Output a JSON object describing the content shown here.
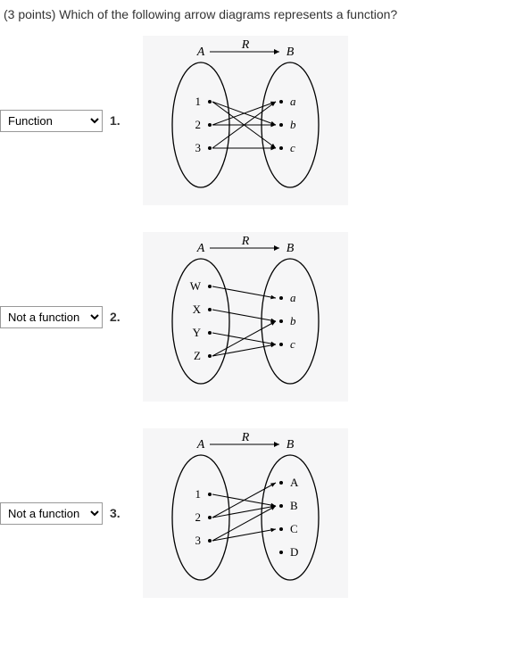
{
  "question": "(3 points) Which of the following arrow diagrams represents a function?",
  "options": [
    "Function",
    "Not a function"
  ],
  "items": [
    {
      "num": "1.",
      "selected": "Function",
      "setA_label": "A",
      "setB_label": "B",
      "rel_label": "R",
      "domain": [
        "1",
        "2",
        "3"
      ],
      "codomain": [
        "a",
        "b",
        "c"
      ],
      "codomain_italic": true,
      "arrows": [
        [
          0,
          1
        ],
        [
          0,
          2
        ],
        [
          1,
          0
        ],
        [
          1,
          1
        ],
        [
          2,
          0
        ],
        [
          2,
          2
        ]
      ]
    },
    {
      "num": "2.",
      "selected": "Not a function",
      "setA_label": "A",
      "setB_label": "B",
      "rel_label": "R",
      "domain": [
        "W",
        "X",
        "Y",
        "Z"
      ],
      "codomain": [
        "a",
        "b",
        "c"
      ],
      "codomain_italic": true,
      "arrows": [
        [
          0,
          0
        ],
        [
          1,
          1
        ],
        [
          2,
          2
        ],
        [
          3,
          1
        ],
        [
          3,
          2
        ]
      ]
    },
    {
      "num": "3.",
      "selected": "Not a function",
      "setA_label": "A",
      "setB_label": "B",
      "rel_label": "R",
      "domain": [
        "1",
        "2",
        "3"
      ],
      "codomain": [
        "A",
        "B",
        "C",
        "D"
      ],
      "codomain_italic": false,
      "arrows": [
        [
          0,
          1
        ],
        [
          1,
          0
        ],
        [
          1,
          1
        ],
        [
          2,
          1
        ],
        [
          2,
          2
        ]
      ]
    }
  ]
}
